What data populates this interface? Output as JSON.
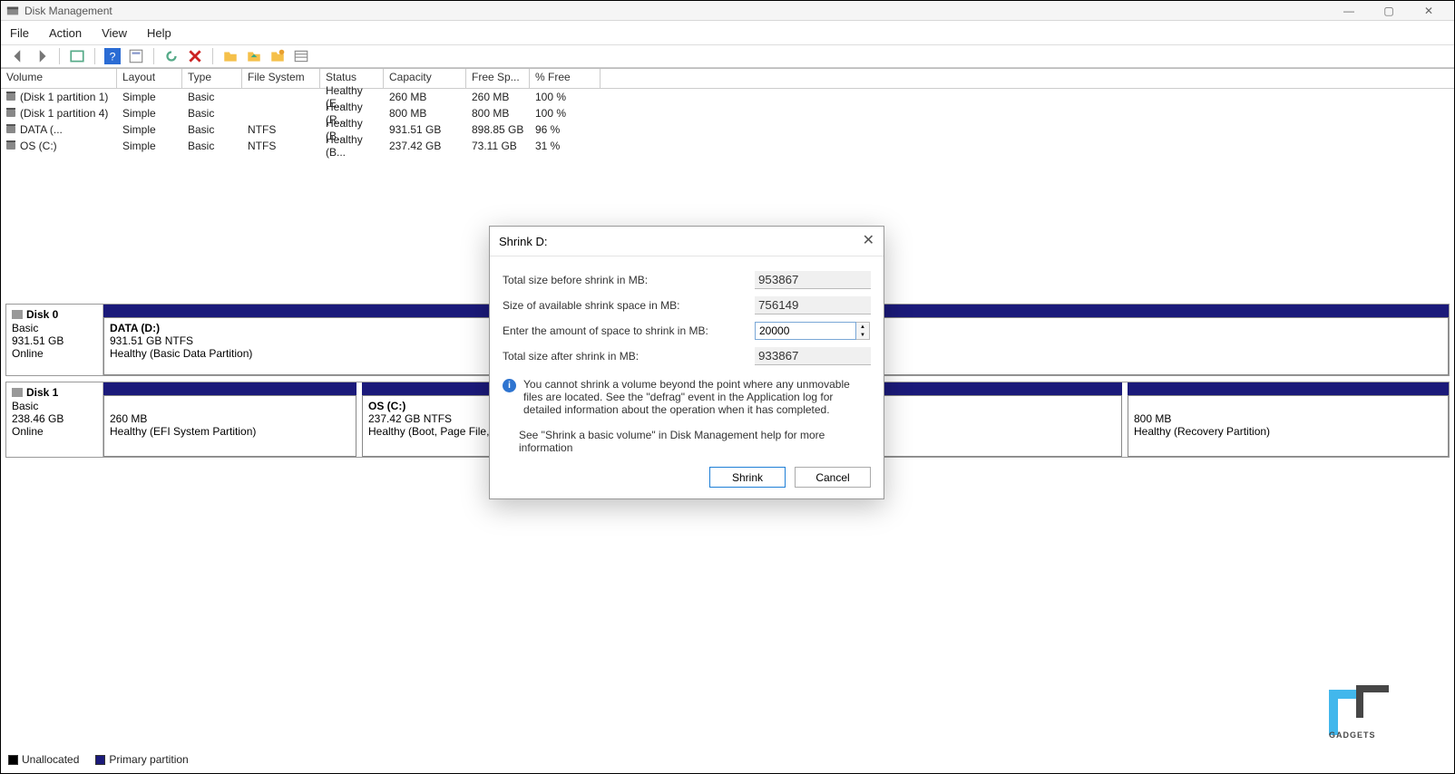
{
  "titlebar": {
    "title": "Disk Management"
  },
  "menu": {
    "file": "File",
    "action": "Action",
    "view": "View",
    "help": "Help"
  },
  "columns": {
    "volume": "Volume",
    "layout": "Layout",
    "type": "Type",
    "fs": "File System",
    "status": "Status",
    "capacity": "Capacity",
    "free": "Free Sp...",
    "pct": "% Free"
  },
  "volumes": [
    {
      "name": "(Disk 1 partition 1)",
      "layout": "Simple",
      "type": "Basic",
      "fs": "",
      "status": "Healthy (E...",
      "capacity": "260 MB",
      "free": "260 MB",
      "pct": "100 %"
    },
    {
      "name": "(Disk 1 partition 4)",
      "layout": "Simple",
      "type": "Basic",
      "fs": "",
      "status": "Healthy (R...",
      "capacity": "800 MB",
      "free": "800 MB",
      "pct": "100 %"
    },
    {
      "name": "DATA (...",
      "layout": "Simple",
      "type": "Basic",
      "fs": "NTFS",
      "status": "Healthy (B...",
      "capacity": "931.51 GB",
      "free": "898.85 GB",
      "pct": "96 %"
    },
    {
      "name": "OS (C:)",
      "layout": "Simple",
      "type": "Basic",
      "fs": "NTFS",
      "status": "Healthy (B...",
      "capacity": "237.42 GB",
      "free": "73.11 GB",
      "pct": "31 %"
    }
  ],
  "disk0": {
    "name": "Disk 0",
    "type": "Basic",
    "size": "931.51 GB",
    "status": "Online",
    "partition": {
      "name": "DATA  (D:)",
      "info": "931.51 GB NTFS",
      "health": "Healthy (Basic Data Partition)"
    }
  },
  "disk1": {
    "name": "Disk 1",
    "type": "Basic",
    "size": "238.46 GB",
    "status": "Online",
    "p1": {
      "info": "260 MB",
      "health": "Healthy (EFI System Partition)"
    },
    "p2": {
      "name": "OS  (C:)",
      "info": "237.42 GB NTFS",
      "health": "Healthy (Boot, Page File, Crash Dump, Basic Data Partition)"
    },
    "p3": {
      "info": "800 MB",
      "health": "Healthy (Recovery Partition)"
    }
  },
  "legend": {
    "unallocated": "Unallocated",
    "primary": "Primary partition"
  },
  "dialog": {
    "title": "Shrink D:",
    "l_before": "Total size before shrink in MB:",
    "v_before": "953867",
    "l_avail": "Size of available shrink space in MB:",
    "v_avail": "756149",
    "l_amount": "Enter the amount of space to shrink in MB:",
    "v_amount": "20000",
    "l_after": "Total size after shrink in MB:",
    "v_after": "933867",
    "info_text": "You cannot shrink a volume beyond the point where any unmovable files are located. See the \"defrag\" event in the Application log for detailed information about the operation when it has completed.",
    "more_text": "See \"Shrink a basic volume\" in Disk Management help for more information",
    "btn_shrink": "Shrink",
    "btn_cancel": "Cancel"
  }
}
